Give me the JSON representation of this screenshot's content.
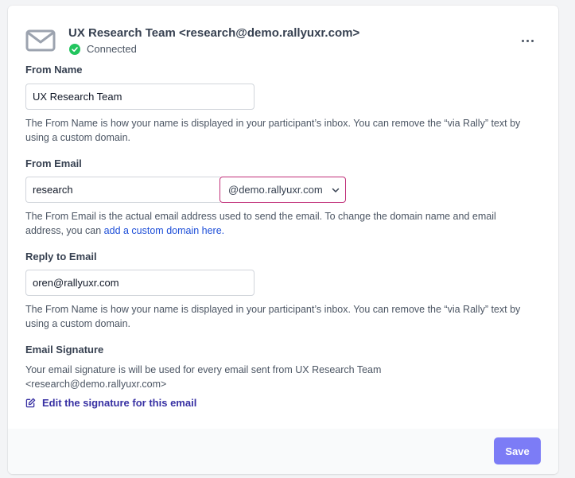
{
  "header": {
    "title": "UX Research Team <research@demo.rallyuxr.com>",
    "status": "Connected",
    "icon": "mail-icon",
    "status_icon": "check-circle-icon",
    "more_icon": "more-horizontal-icon"
  },
  "from_name": {
    "label": "From Name",
    "value": "UX Research Team",
    "help": "The From Name is how your name is displayed in your participant’s inbox. You can remove the “via Rally” text by using a custom domain."
  },
  "from_email": {
    "label": "From Email",
    "local_part": "research",
    "domain": "@demo.rallyuxr.com",
    "help_prefix": "The From Email is the actual email address used to send the email. To change the domain name and email address, you can ",
    "help_link": "add a custom domain here."
  },
  "reply_to": {
    "label": "Reply to Email",
    "value": "oren@rallyuxr.com",
    "help": "The From Name is how your name is displayed in your participant’s inbox. You can remove the “via Rally” text by using a custom domain."
  },
  "signature": {
    "label": "Email Signature",
    "help": "Your email signature is will be used for every email sent from UX Research Team <research@demo.rallyuxr.com>",
    "edit_label": "Edit the signature for this email",
    "edit_icon": "edit-icon"
  },
  "footer": {
    "save_label": "Save"
  },
  "colors": {
    "accent": "#7c7cf6",
    "link": "#1d4ed8",
    "select_border": "#c02f78",
    "connected": "#22c55e"
  }
}
